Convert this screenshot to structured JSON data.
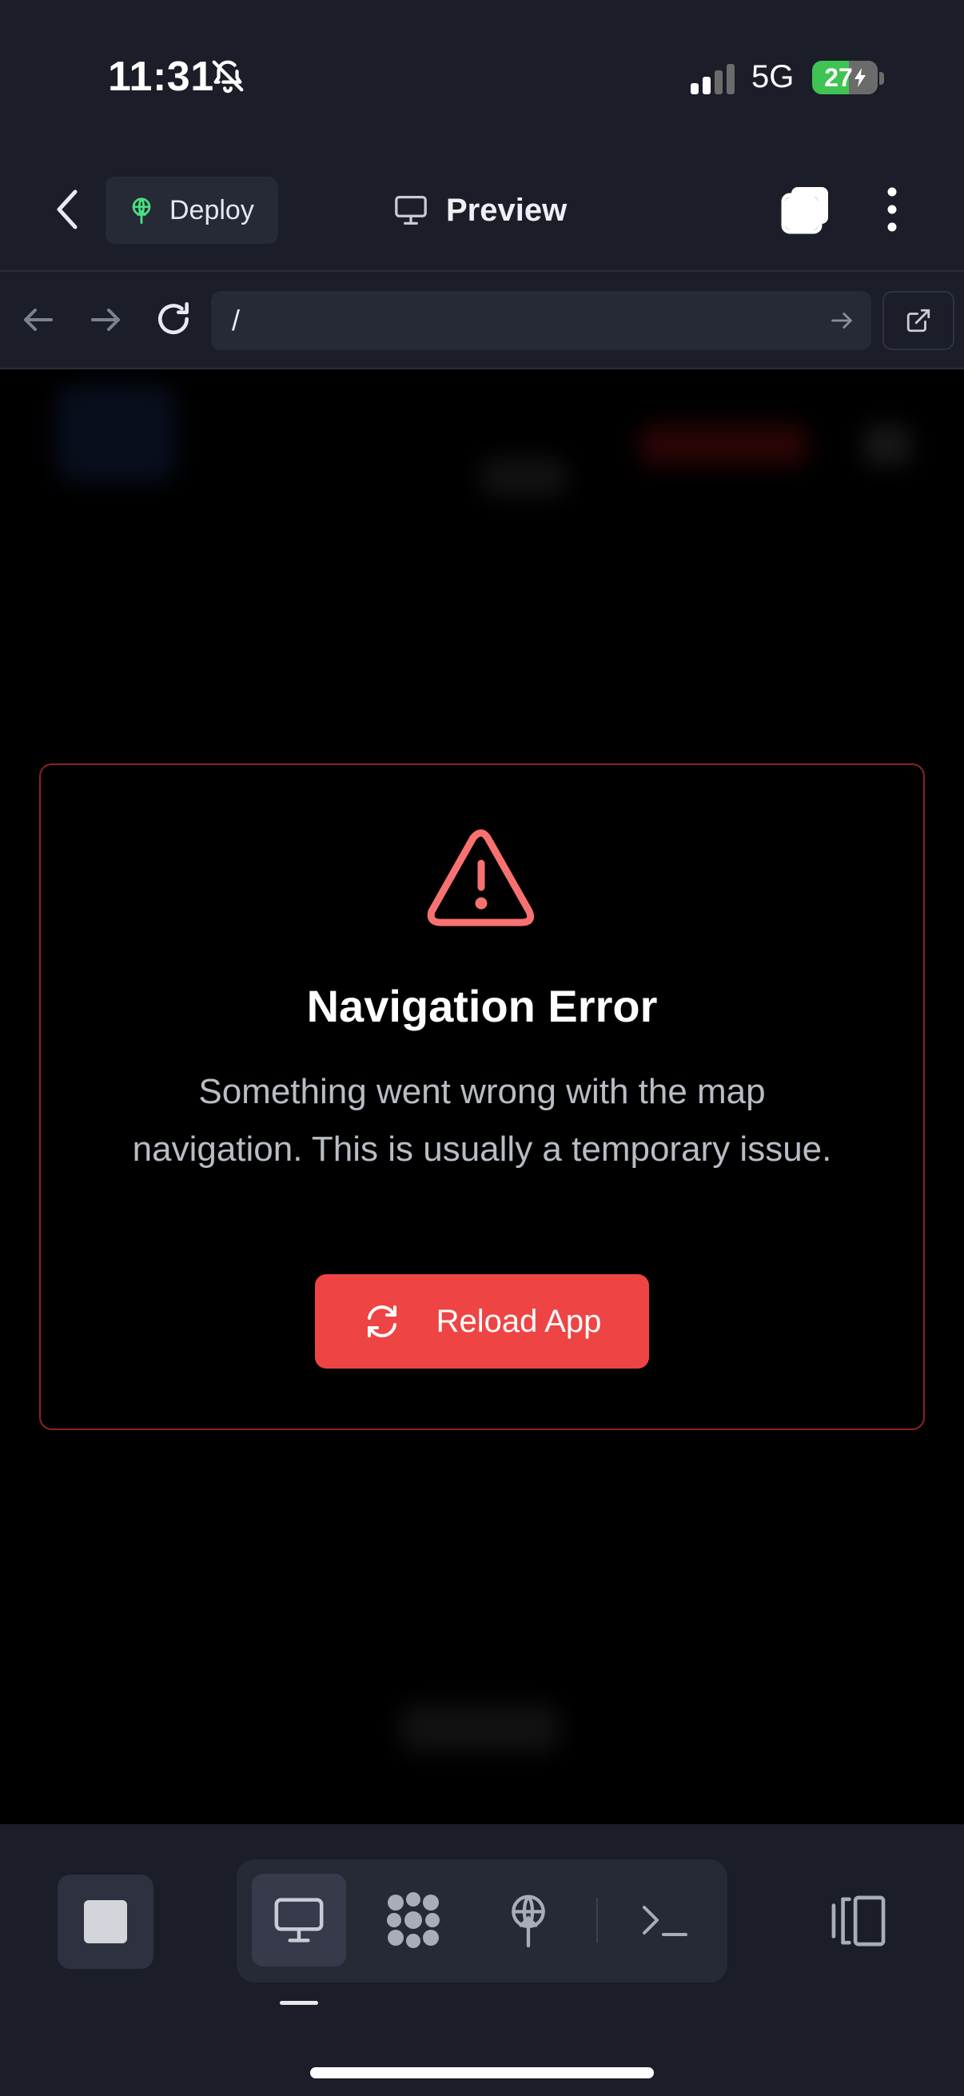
{
  "status_bar": {
    "time": "11:31",
    "network": "5G",
    "battery": "27"
  },
  "header": {
    "deploy_label": "Deploy",
    "preview_label": "Preview"
  },
  "url_bar": {
    "value": "/"
  },
  "error": {
    "title": "Navigation Error",
    "message": "Something went wrong with the map navigation. This is usually a temporary issue.",
    "button_label": "Reload App"
  },
  "icons": {
    "back": "chevron-left-icon",
    "deploy": "deploy-icon",
    "preview": "monitor-icon",
    "windows": "windows-icon",
    "more": "more-vertical-icon",
    "warning": "warning-triangle-icon",
    "reload": "refresh-icon",
    "stop": "stop-icon",
    "tools": [
      "monitor-icon",
      "grid-icon",
      "deploy-icon",
      "terminal-icon"
    ],
    "layout": "split-view-icon"
  },
  "colors": {
    "accent_red": "#ef4444",
    "card_border": "#8a2323",
    "deploy_green": "#4ade80",
    "battery_green": "#3fc352"
  }
}
